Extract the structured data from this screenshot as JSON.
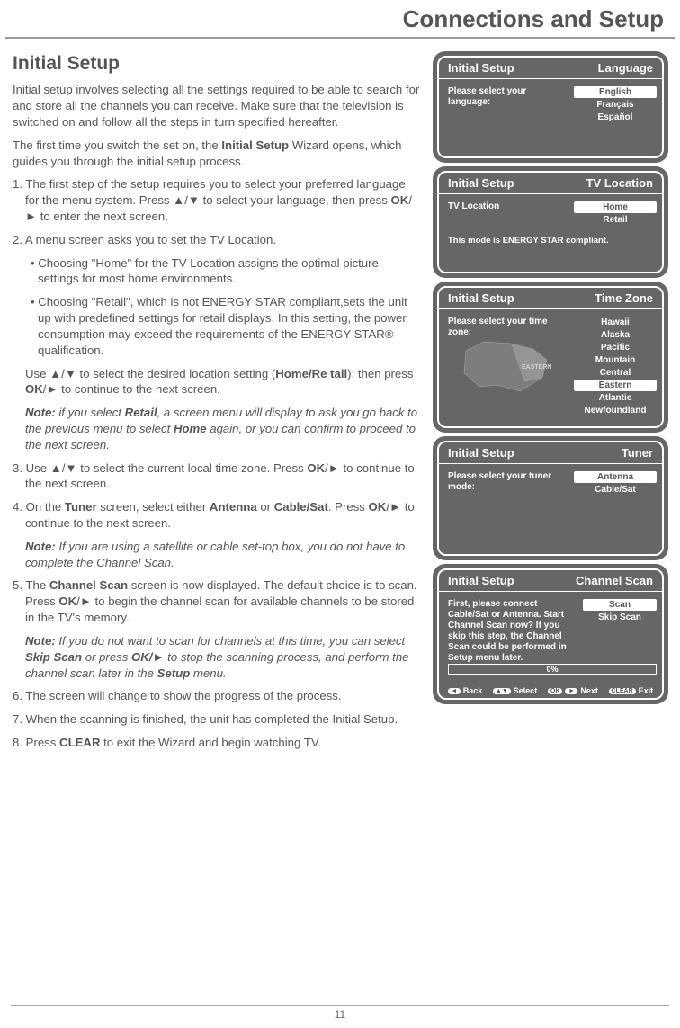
{
  "page_title": "Connections and Setup",
  "page_number": "11",
  "main": {
    "heading": "Initial Setup",
    "intro1": "Initial setup involves selecting all the settings required to be able to search for and store all the channels you can receive. Make sure that the television is switched on and follow all the steps in turn specified hereafter.",
    "intro2_a": "The first time you switch the set on, the ",
    "intro2_b": "Initial Setup",
    "intro2_c": " Wizard opens, which guides you through the initial setup process.",
    "step1_a": "1. The first step of the setup requires you to select your preferred language for the menu system. Press ▲/▼ to select your language, then press ",
    "step1_b": "OK",
    "step1_c": "/► to enter the next screen.",
    "step2_head": "2. A menu screen asks you to set the TV Location.",
    "step2_b1": "• Choosing \"Home\" for the TV Location assigns the optimal picture settings for most home environments.",
    "step2_b2": "• Choosing \"Retail\", which is not ENERGY STAR compliant,sets the unit up with predefined settings for retail displays. In this setting, the power consumption may exceed the requirements of the ENERGY STAR® qualification.",
    "step2_use_a": "Use ▲/▼ to select the desired location setting (",
    "step2_use_b": "Home/Re tail",
    "step2_use_c": "); then press ",
    "step2_use_d": "OK",
    "step2_use_e": "/► to continue to the next screen.",
    "step2_note_a": "Note:",
    "step2_note_b": " if you select ",
    "step2_note_c": "Retail",
    "step2_note_d": ", a screen menu will display to ask you go back to the previous menu to select ",
    "step2_note_e": "Home",
    "step2_note_f": " again, or you can confirm to proceed to the next screen.",
    "step3_a": "3. Use ▲/▼ to select the current local time zone. Press ",
    "step3_b": "OK",
    "step3_c": "/► to continue to the next screen.",
    "step4_a": "4. On the ",
    "step4_b": "Tuner",
    "step4_c": " screen, select either ",
    "step4_d": "Antenna",
    "step4_e": " or ",
    "step4_f": "Cable/Sat",
    "step4_g": ". Press ",
    "step4_h": "OK",
    "step4_i": "/► to continue to the next screen.",
    "step4_note_a": "Note:",
    "step4_note_b": " If you are using a satellite or cable set-top box, you do not have to complete the Channel Scan.",
    "step5_a": "5. The ",
    "step5_b": "Channel Scan",
    "step5_c": " screen is now displayed. The default choice is to scan. Press ",
    "step5_d": "OK",
    "step5_e": "/► to begin the channel scan for available channels to be stored in the TV's memory.",
    "step5_note_a": "Note:",
    "step5_note_b": " If you do not want to scan for channels at this time, you can select ",
    "step5_note_c": "Skip Scan",
    "step5_note_d": " or press ",
    "step5_note_e": "OK/►",
    "step5_note_f": " to stop the scanning process, and perform the channel scan later in the ",
    "step5_note_g": "Setup",
    "step5_note_h": " menu.",
    "step6": "6. The screen will change to show the progress of the process.",
    "step7": "7. When the scanning is finished, the unit has completed the Initial Setup.",
    "step8_a": "8. Press ",
    "step8_b": "CLEAR",
    "step8_c": " to exit the Wizard and begin watching TV."
  },
  "screens": {
    "lang": {
      "title": "Initial Setup",
      "subtitle": "Language",
      "prompt": "Please select your language:",
      "options": [
        "English",
        "Français",
        "Español"
      ],
      "selected": 0
    },
    "loc": {
      "title": "Initial Setup",
      "subtitle": "TV Location",
      "prompt": "TV Location",
      "options": [
        "Home",
        "Retail"
      ],
      "selected": 0,
      "note": "This mode is ENERGY STAR compliant."
    },
    "tz": {
      "title": "Initial Setup",
      "subtitle": "Time Zone",
      "prompt": "Please select your time zone:",
      "options": [
        "Hawaii",
        "Alaska",
        "Pacific",
        "Mountain",
        "Central",
        "Eastern",
        "Atlantic",
        "Newfoundland"
      ],
      "selected": 5,
      "map_label": "EASTERN"
    },
    "tuner": {
      "title": "Initial Setup",
      "subtitle": "Tuner",
      "prompt": "Please select your tuner mode:",
      "options": [
        "Antenna",
        "Cable/Sat"
      ],
      "selected": 0
    },
    "scan": {
      "title": "Initial Setup",
      "subtitle": "Channel Scan",
      "prompt": "First, please connect Cable/Sat or Antenna. Start Channel Scan now? If you skip this step, the Channel Scan could be performed in Setup menu later.",
      "options": [
        "Scan",
        "Skip Scan"
      ],
      "selected": 0,
      "progress": "0%",
      "hints": {
        "back": "Back",
        "select": "Select",
        "next": "Next",
        "exit": "Exit",
        "ok_key": "OK",
        "clear_key": "CLEAR"
      }
    }
  }
}
